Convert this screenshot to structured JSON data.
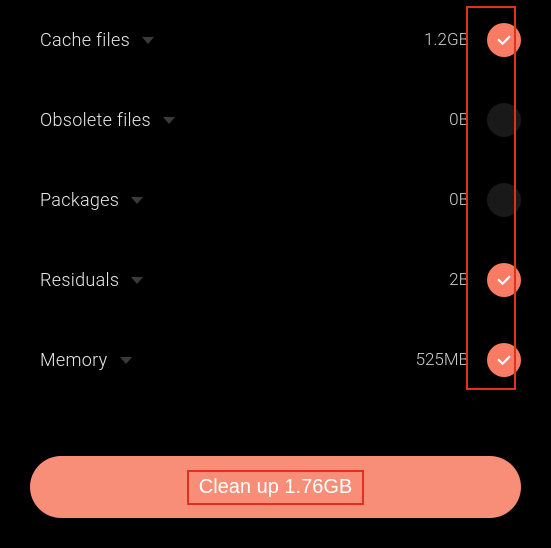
{
  "items": [
    {
      "label": "Cache files",
      "size": "1.2GB",
      "checked": true
    },
    {
      "label": "Obsolete files",
      "size": "0B",
      "checked": false
    },
    {
      "label": "Packages",
      "size": "0B",
      "checked": false
    },
    {
      "label": "Residuals",
      "size": "2B",
      "checked": true
    },
    {
      "label": "Memory",
      "size": "525MB",
      "checked": true
    }
  ],
  "button": {
    "label": "Clean up 1.76GB"
  },
  "colors": {
    "accent": "#f87b64",
    "button": "#f88e78",
    "highlight": "#e0301e"
  }
}
